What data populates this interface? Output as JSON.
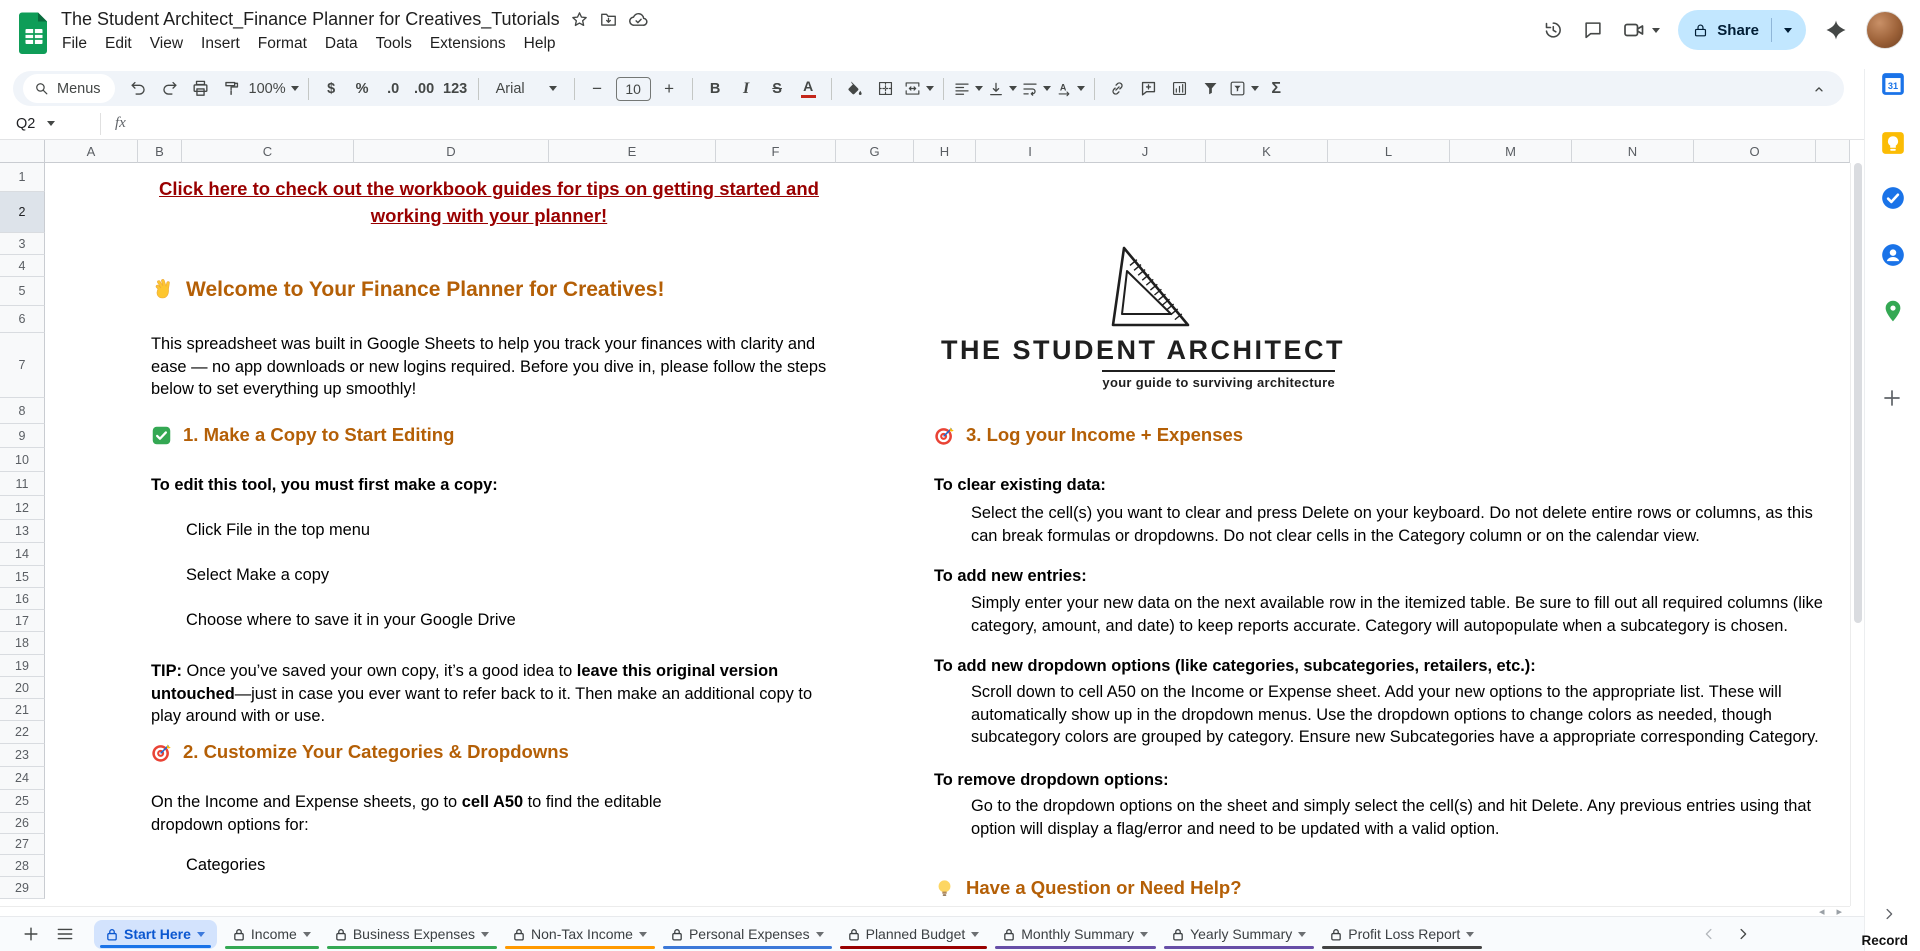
{
  "topbar": {
    "title": "The Student Architect_Finance Planner for Creatives_Tutorials",
    "menus": [
      "File",
      "Edit",
      "View",
      "Insert",
      "Format",
      "Data",
      "Tools",
      "Extensions",
      "Help"
    ],
    "share_label": "Share"
  },
  "toolbar": {
    "menus_label": "Menus",
    "zoom_value": "100%",
    "currency": "$",
    "percent": "%",
    "decrease_decimal": ".0",
    "increase_decimal": ".00",
    "more_formats": "123",
    "font_name": "Arial",
    "minus": "−",
    "font_size": "10",
    "plus": "+",
    "bold": "B",
    "italic": "I",
    "strikethrough": "S",
    "text_color": "A",
    "functions": "Σ"
  },
  "formula_bar": {
    "name_box": "Q2",
    "fx_label": "fx"
  },
  "grid": {
    "columns": [
      "A",
      "B",
      "C",
      "D",
      "E",
      "F",
      "G",
      "H",
      "I",
      "J",
      "K",
      "L",
      "M",
      "N",
      "O"
    ],
    "rows": [
      "1",
      "2",
      "3",
      "4",
      "5",
      "6",
      "7",
      "8",
      "9",
      "10",
      "11",
      "12",
      "13",
      "14",
      "15",
      "16",
      "17",
      "18",
      "19",
      "20",
      "21",
      "22",
      "23",
      "24",
      "25",
      "26",
      "27",
      "28",
      "29"
    ],
    "selected_cell": "Q2",
    "selected_row": "2"
  },
  "content": {
    "link_line1": "Click here to check out the workbook guides for tips on getting started and",
    "link_line2": "working with your planner!",
    "welcome_title": "Welcome to Your Finance Planner for Creatives!",
    "intro": "This spreadsheet was built in Google Sheets to help you track your finances with clarity and ease — no app downloads or new logins required. Before you dive in, please follow the steps below to set everything up smoothly!",
    "s1_title": "1. Make a Copy to Start Editing",
    "s1_lead": "To edit this tool, you must first make a copy:",
    "s1_steps": [
      "Click File in the top menu",
      "Select Make a copy",
      "Choose where to save it in your Google Drive"
    ],
    "tip_label": "TIP:",
    "tip_text1": " Once you’ve saved your own copy, it’s a good idea to ",
    "tip_bold": "leave this original version untouched",
    "tip_text2": "—just in case you ever want to refer back to it. Then make an additional copy to play around with or use.",
    "s2_title": "2. Customize Your Categories & Dropdowns",
    "s2_lead1": "On the Income and Expense sheets, go to ",
    "s2_bold": "cell A50",
    "s2_lead2": " to find the editable dropdown options for:",
    "s2_item": "Categories",
    "logo_title": "THE STUDENT ARCHITECT",
    "logo_tagline": "your guide to surviving architecture",
    "s3_title": "3. Log your Income + Expenses",
    "clear_title": "To clear existing data:",
    "clear_body": "Select the cell(s) you want to clear and press Delete on your keyboard. Do not delete entire rows or columns, as this can break formulas or dropdowns. Do not clear cells in the Category column or on the calendar view.",
    "add_title": "To add new entries:",
    "add_body": "Simply enter your new data on the next available row in the itemized table. Be sure to fill out all required columns (like category, amount, and date) to keep reports accurate. Category will autopopulate when a subcategory is chosen.",
    "dd_title": "To add new dropdown options (like categories, subcategories, retailers, etc.):",
    "dd_body": "Scroll down to cell A50 on the Income or Expense sheet. Add your new options to the appropriate list. These will automatically show up in the dropdown menus. Use the dropdown options to change colors as needed, though subcategory colors are grouped by category. Ensure new Subcategories have a appropriate corresponding Category.",
    "rm_title": "To remove dropdown options:",
    "rm_body": "Go to the dropdown options on the sheet and simply select the cell(s) and hit Delete. Any previous entries using that option will display a flag/error and need to be updated with a valid option.",
    "help_title": "Have a Question or Need Help?"
  },
  "sheet_tabs": [
    {
      "label": "Start Here",
      "active": true,
      "color": "#1a73e8"
    },
    {
      "label": "Income",
      "active": false,
      "color": "#34a853"
    },
    {
      "label": "Business Expenses",
      "active": false,
      "color": "#34a853"
    },
    {
      "label": "Non-Tax Income",
      "active": false,
      "color": "#ff9900"
    },
    {
      "label": "Personal Expenses",
      "active": false,
      "color": "#3c78d8"
    },
    {
      "label": "Planned Budget",
      "active": false,
      "color": "#990000"
    },
    {
      "label": "Monthly Summary",
      "active": false,
      "color": "#674ea7"
    },
    {
      "label": "Yearly Summary",
      "active": false,
      "color": "#674ea7"
    },
    {
      "label": "Profit Loss Report",
      "active": false,
      "color": "#434343"
    }
  ],
  "colors": {
    "heading_orange": "#b45f06",
    "link_red": "#990000",
    "active_tab_blue": "#0b57d0",
    "share_button": "#c2e7ff"
  },
  "overlay": {
    "record_label": "Record"
  }
}
